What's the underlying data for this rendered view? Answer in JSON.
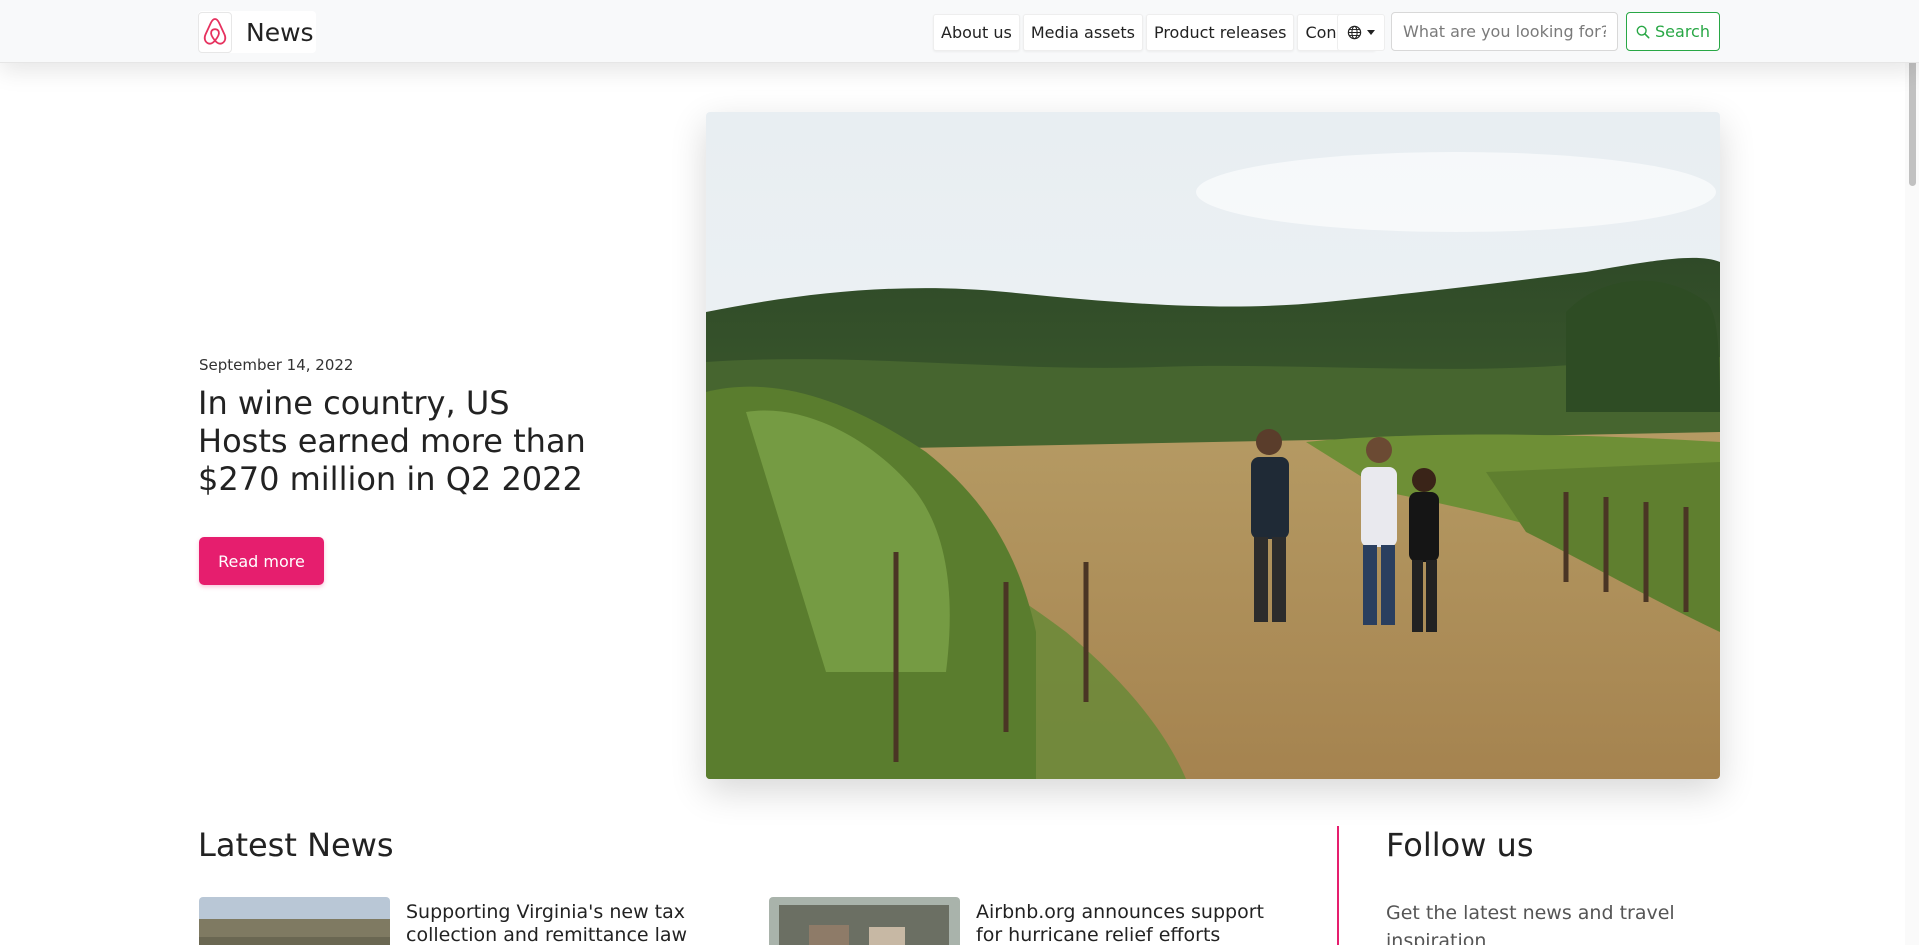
{
  "header": {
    "brand_title": "News",
    "nav": [
      {
        "label": "About us"
      },
      {
        "label": "Media assets"
      },
      {
        "label": "Product releases"
      },
      {
        "label": "Contact"
      }
    ],
    "language_icon": "globe-icon",
    "search_placeholder": "What are you looking for?",
    "search_label": "Search"
  },
  "hero": {
    "date": "September 14, 2022",
    "title": "In wine country, US Hosts earned more than $270 million in Q2 2022",
    "button_label": "Read more"
  },
  "latest": {
    "heading": "Latest News",
    "items": [
      {
        "title": "Supporting Virginia's new tax collection and remittance law"
      },
      {
        "title": "Airbnb.org announces support for hurricane relief efforts"
      }
    ]
  },
  "follow": {
    "heading": "Follow us",
    "text": "Get the latest news and travel inspiration"
  },
  "colors": {
    "accent": "#e61e6e",
    "search": "#28a745",
    "nav_bg": "#f8f9fa"
  }
}
